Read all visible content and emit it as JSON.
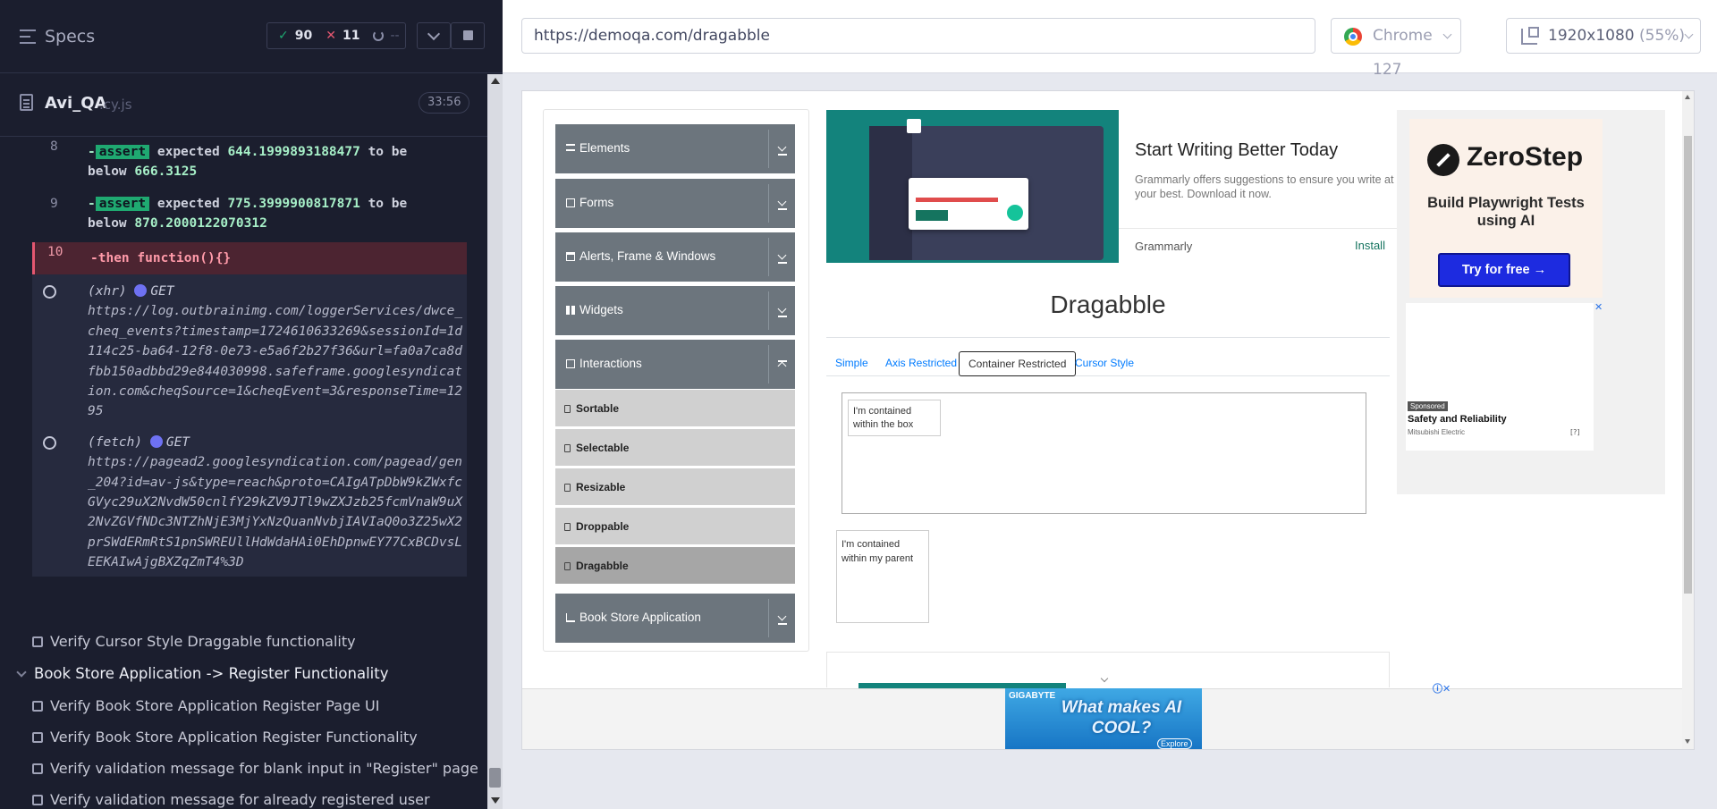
{
  "runner": {
    "specs_title": "Specs",
    "stats": {
      "passed": "90",
      "failed": "11",
      "pending": "--"
    },
    "spec_file": {
      "name": "Avi_QA",
      "ext": ".cy.js",
      "duration": "33:56"
    }
  },
  "log": {
    "rows": [
      {
        "num": "8",
        "tag": "assert",
        "text_a": "expected",
        "value_a": "644.1999893188477",
        "text_b": "to be",
        "text_c": "below",
        "value_b": "666.3125"
      },
      {
        "num": "9",
        "tag": "assert",
        "text_a": "expected",
        "value_a": "775.3999900817871",
        "text_b": "to be",
        "text_c": "below",
        "value_b": "870.2000122070312"
      }
    ],
    "failed_row": {
      "num": "10",
      "cmd": "-then",
      "text": "function(){}"
    },
    "requests": [
      {
        "type": "(xhr)",
        "method": "GET",
        "url": "https://log.outbrainimg.com/loggerServices/dwce_cheq_events?timestamp=1724610633269&sessionId=1d114c25-ba64-12f8-0e73-e5a6f2b27f36&url=fa0a7ca8dfbb150adbbd29e844030998.safeframe.googlesyndication.com&cheqSource=1&cheqEvent=3&responseTime=1295"
      },
      {
        "type": "(fetch)",
        "method": "GET",
        "url": "https://pagead2.googlesyndication.com/pagead/gen_204?id=av-js&type=reach&proto=CAIgATpDbW9kZWxfcGVyc29uX2NvdW50cnlfY29kZV9JTl9wZXJzb25fcmVnaW9uX2NvZGVfNDc3NTZhNjE3MjYxNzQuanNvbjIAVIaQ0o3Z25wX2prSWdERmRtS1pnSWREUllHdWdaHAi0EhDpnwEY77CxBCDvsLEEKAIwAjgBXZqZmT4%3D"
      }
    ]
  },
  "tests": {
    "item_cursor": "Verify Cursor Style Draggable functionality",
    "suite": "Book Store Application -> Register Functionality",
    "items": [
      "Verify Book Store Application Register Page UI",
      "Verify Book Store Application Register Functionality",
      "Verify validation message for blank input in \"Register\" page",
      "Verify validation message for already registered user"
    ]
  },
  "browser": {
    "url": "https://demoqa.com/dragabble",
    "name": "Chrome 127",
    "viewport": "1920x1080",
    "scale": "(55%)"
  },
  "aut": {
    "menu": {
      "groups": [
        "Elements",
        "Forms",
        "Alerts, Frame & Windows",
        "Widgets",
        "Interactions",
        "Book Store Application"
      ],
      "interactions_items": [
        "Sortable",
        "Selectable",
        "Resizable",
        "Droppable",
        "Dragabble"
      ]
    },
    "ad_grammarly": {
      "title": "Start Writing Better Today",
      "desc": "Grammarly offers suggestions to ensure you write at your best. Download it now.",
      "brand": "Grammarly",
      "cta": "Install"
    },
    "ad_zerostep": {
      "name": "ZeroStep",
      "tagline": "Build Playwright Tests using AI",
      "cta": "Try for free →",
      "sponsored": "Sponsored",
      "sponsored_title": "Safety and Reliability",
      "sponsored_brand": "Mitsubishi Electric"
    },
    "page_title": "Dragabble",
    "tabs": [
      "Simple",
      "Axis Restricted",
      "Container Restricted",
      "Cursor Style"
    ],
    "box_text": "I'm contained within the box",
    "parent_text": "I'm contained within my parent",
    "ad_gigabyte": {
      "brand": "GIGABYTE",
      "text": "What makes AI COOL?",
      "cta": "Explore"
    }
  },
  "colors": {
    "runner_bg": "#1b1e2e",
    "pass": "#1fa971",
    "fail": "#e45770",
    "menu_group": "#6c757d",
    "link": "#007bff",
    "zerostep_button": "#1d2be0"
  }
}
